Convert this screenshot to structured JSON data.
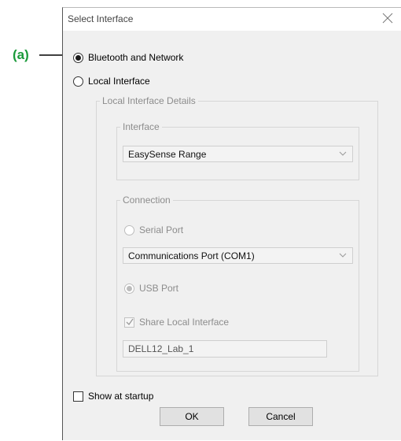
{
  "annotation": {
    "label": "(a)",
    "color": "#1a9a3a"
  },
  "dialog": {
    "title": "Select Interface",
    "close_icon": "close-icon"
  },
  "options": {
    "bluetooth_network": {
      "label": "Bluetooth and Network",
      "checked": true
    },
    "local_interface": {
      "label": "Local Interface",
      "checked": false
    }
  },
  "local_details": {
    "group_label": "Local Interface Details",
    "interface_group": {
      "label": "Interface",
      "selected": "EasySense Range"
    },
    "connection_group": {
      "label": "Connection",
      "serial_port_label": "Serial Port",
      "port_selected": "Communications Port (COM1)",
      "usb_port_label": "USB Port"
    },
    "share": {
      "label": "Share Local Interface",
      "checked": true,
      "name_value": "DELL12_Lab_1"
    }
  },
  "footer": {
    "show_at_startup_label": "Show at startup",
    "ok_label": "OK",
    "cancel_label": "Cancel"
  }
}
